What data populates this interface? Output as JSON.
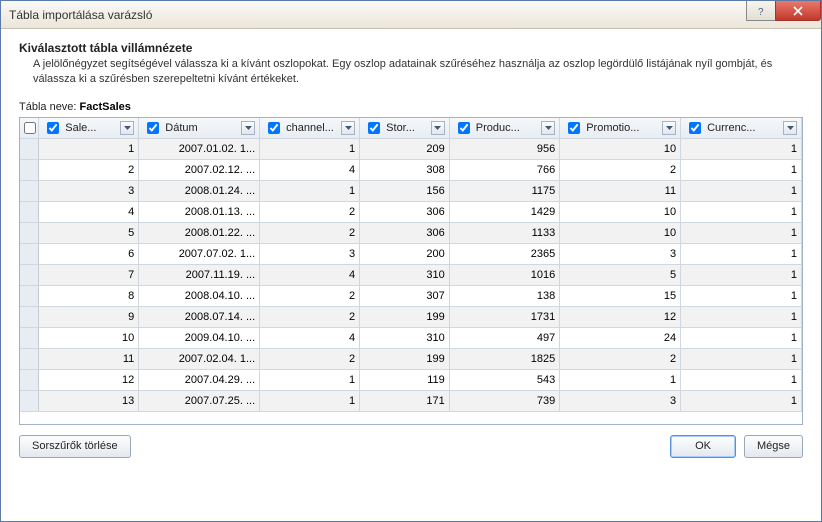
{
  "window": {
    "title": "Tábla importálása varázsló"
  },
  "header": {
    "title": "Kiválasztott tábla villámnézete",
    "description": "A jelölőnégyzet segítségével válassza ki a kívánt oszlopokat. Egy oszlop adatainak szűréséhez használja az oszlop legördülő listájának nyíl gombját, és válassza ki a szűrésben szerepeltetni kívánt értékeket."
  },
  "table_name": {
    "label": "Tábla neve:",
    "value": "FactSales"
  },
  "columns": [
    {
      "label": "Sale...",
      "checked": true
    },
    {
      "label": "Dátum",
      "checked": true
    },
    {
      "label": "channel...",
      "checked": true
    },
    {
      "label": "Stor...",
      "checked": true
    },
    {
      "label": "Produc...",
      "checked": true
    },
    {
      "label": "Promotio...",
      "checked": true
    },
    {
      "label": "Currenc...",
      "checked": true
    }
  ],
  "rows": [
    {
      "sale": 1,
      "date": "2007.01.02. 1...",
      "channel": 1,
      "store": 209,
      "product": 956,
      "promo": 10,
      "currency": 1
    },
    {
      "sale": 2,
      "date": "2007.02.12. ...",
      "channel": 4,
      "store": 308,
      "product": 766,
      "promo": 2,
      "currency": 1
    },
    {
      "sale": 3,
      "date": "2008.01.24. ...",
      "channel": 1,
      "store": 156,
      "product": 1175,
      "promo": 11,
      "currency": 1
    },
    {
      "sale": 4,
      "date": "2008.01.13. ...",
      "channel": 2,
      "store": 306,
      "product": 1429,
      "promo": 10,
      "currency": 1
    },
    {
      "sale": 5,
      "date": "2008.01.22. ...",
      "channel": 2,
      "store": 306,
      "product": 1133,
      "promo": 10,
      "currency": 1
    },
    {
      "sale": 6,
      "date": "2007.07.02. 1...",
      "channel": 3,
      "store": 200,
      "product": 2365,
      "promo": 3,
      "currency": 1
    },
    {
      "sale": 7,
      "date": "2007.11.19. ...",
      "channel": 4,
      "store": 310,
      "product": 1016,
      "promo": 5,
      "currency": 1
    },
    {
      "sale": 8,
      "date": "2008.04.10. ...",
      "channel": 2,
      "store": 307,
      "product": 138,
      "promo": 15,
      "currency": 1
    },
    {
      "sale": 9,
      "date": "2008.07.14. ...",
      "channel": 2,
      "store": 199,
      "product": 1731,
      "promo": 12,
      "currency": 1
    },
    {
      "sale": 10,
      "date": "2009.04.10. ...",
      "channel": 4,
      "store": 310,
      "product": 497,
      "promo": 24,
      "currency": 1
    },
    {
      "sale": 11,
      "date": "2007.02.04. 1...",
      "channel": 2,
      "store": 199,
      "product": 1825,
      "promo": 2,
      "currency": 1
    },
    {
      "sale": 12,
      "date": "2007.04.29. ...",
      "channel": 1,
      "store": 119,
      "product": 543,
      "promo": 1,
      "currency": 1
    },
    {
      "sale": 13,
      "date": "2007.07.25. ...",
      "channel": 1,
      "store": 171,
      "product": 739,
      "promo": 3,
      "currency": 1
    }
  ],
  "buttons": {
    "clear_filters": "Sorszűrők törlése",
    "ok": "OK",
    "cancel": "Mégse"
  }
}
